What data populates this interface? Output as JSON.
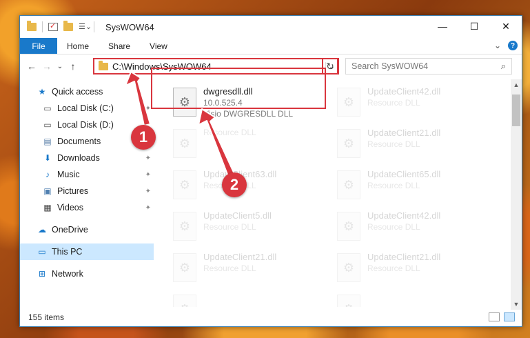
{
  "window": {
    "title": "SysWOW64",
    "minimize_glyph": "—",
    "maximize_glyph": "☐",
    "close_glyph": "✕"
  },
  "ribbon": {
    "tabs": [
      "File",
      "Home",
      "Share",
      "View"
    ],
    "expand_glyph": "⌄",
    "help_glyph": "?"
  },
  "nav": {
    "back_glyph": "←",
    "forward_glyph": "→",
    "recent_glyph": "⌄",
    "up_glyph": "↑",
    "address": "C:\\Windows\\SysWOW64",
    "address_dropdown_glyph": "⌄",
    "refresh_glyph": "↻",
    "search_placeholder": "Search SysWOW64",
    "search_icon_glyph": "⌕"
  },
  "sidebar": {
    "quick_access": "Quick access",
    "items": [
      {
        "label": "Local Disk (C:)",
        "icon": "drive-icon",
        "pinned": true
      },
      {
        "label": "Local Disk (D:)",
        "icon": "drive-icon",
        "pinned": false
      },
      {
        "label": "Documents",
        "icon": "documents-icon",
        "pinned": true
      },
      {
        "label": "Downloads",
        "icon": "downloads-icon",
        "pinned": true
      },
      {
        "label": "Music",
        "icon": "music-icon",
        "pinned": true
      },
      {
        "label": "Pictures",
        "icon": "pictures-icon",
        "pinned": true
      },
      {
        "label": "Videos",
        "icon": "videos-icon",
        "pinned": true
      }
    ],
    "onedrive": "OneDrive",
    "this_pc": "This PC",
    "network": "Network",
    "pin_glyph": "📌"
  },
  "files": [
    {
      "name": "dwgresdll.dll",
      "line1": "10.0.525.4",
      "line2": "Visio DWGRESDLL DLL",
      "faded": false
    },
    {
      "name": "UpdateClient42.dll",
      "line1": "Resource DLL",
      "faded": true
    },
    {
      "name": "",
      "line1": "Resource DLL",
      "faded": true
    },
    {
      "name": "UpdateClient21.dll",
      "line1": "Resource DLL",
      "faded": true
    },
    {
      "name": "UpdateClient63.dll",
      "line1": "Resource DLL",
      "faded": true
    },
    {
      "name": "UpdateClient65.dll",
      "line1": "Resource DLL",
      "faded": true
    },
    {
      "name": "UpdateClient5.dll",
      "line1": "Resource DLL",
      "faded": true
    },
    {
      "name": "UpdateClient42.dll",
      "line1": "Resource DLL",
      "faded": true
    },
    {
      "name": "UpdateClient21.dll",
      "line1": "Resource DLL",
      "faded": true
    },
    {
      "name": "UpdateClient21.dll",
      "line1": "Resource DLL",
      "faded": true
    },
    {
      "name": "",
      "line1": "",
      "faded": true
    },
    {
      "name": "",
      "line1": "",
      "faded": true
    }
  ],
  "status": {
    "item_count": "155 items"
  },
  "callouts": [
    "1",
    "2"
  ],
  "colors": {
    "accent": "#1979ca",
    "highlight_red": "#d9363e",
    "selection": "#cce8ff"
  }
}
